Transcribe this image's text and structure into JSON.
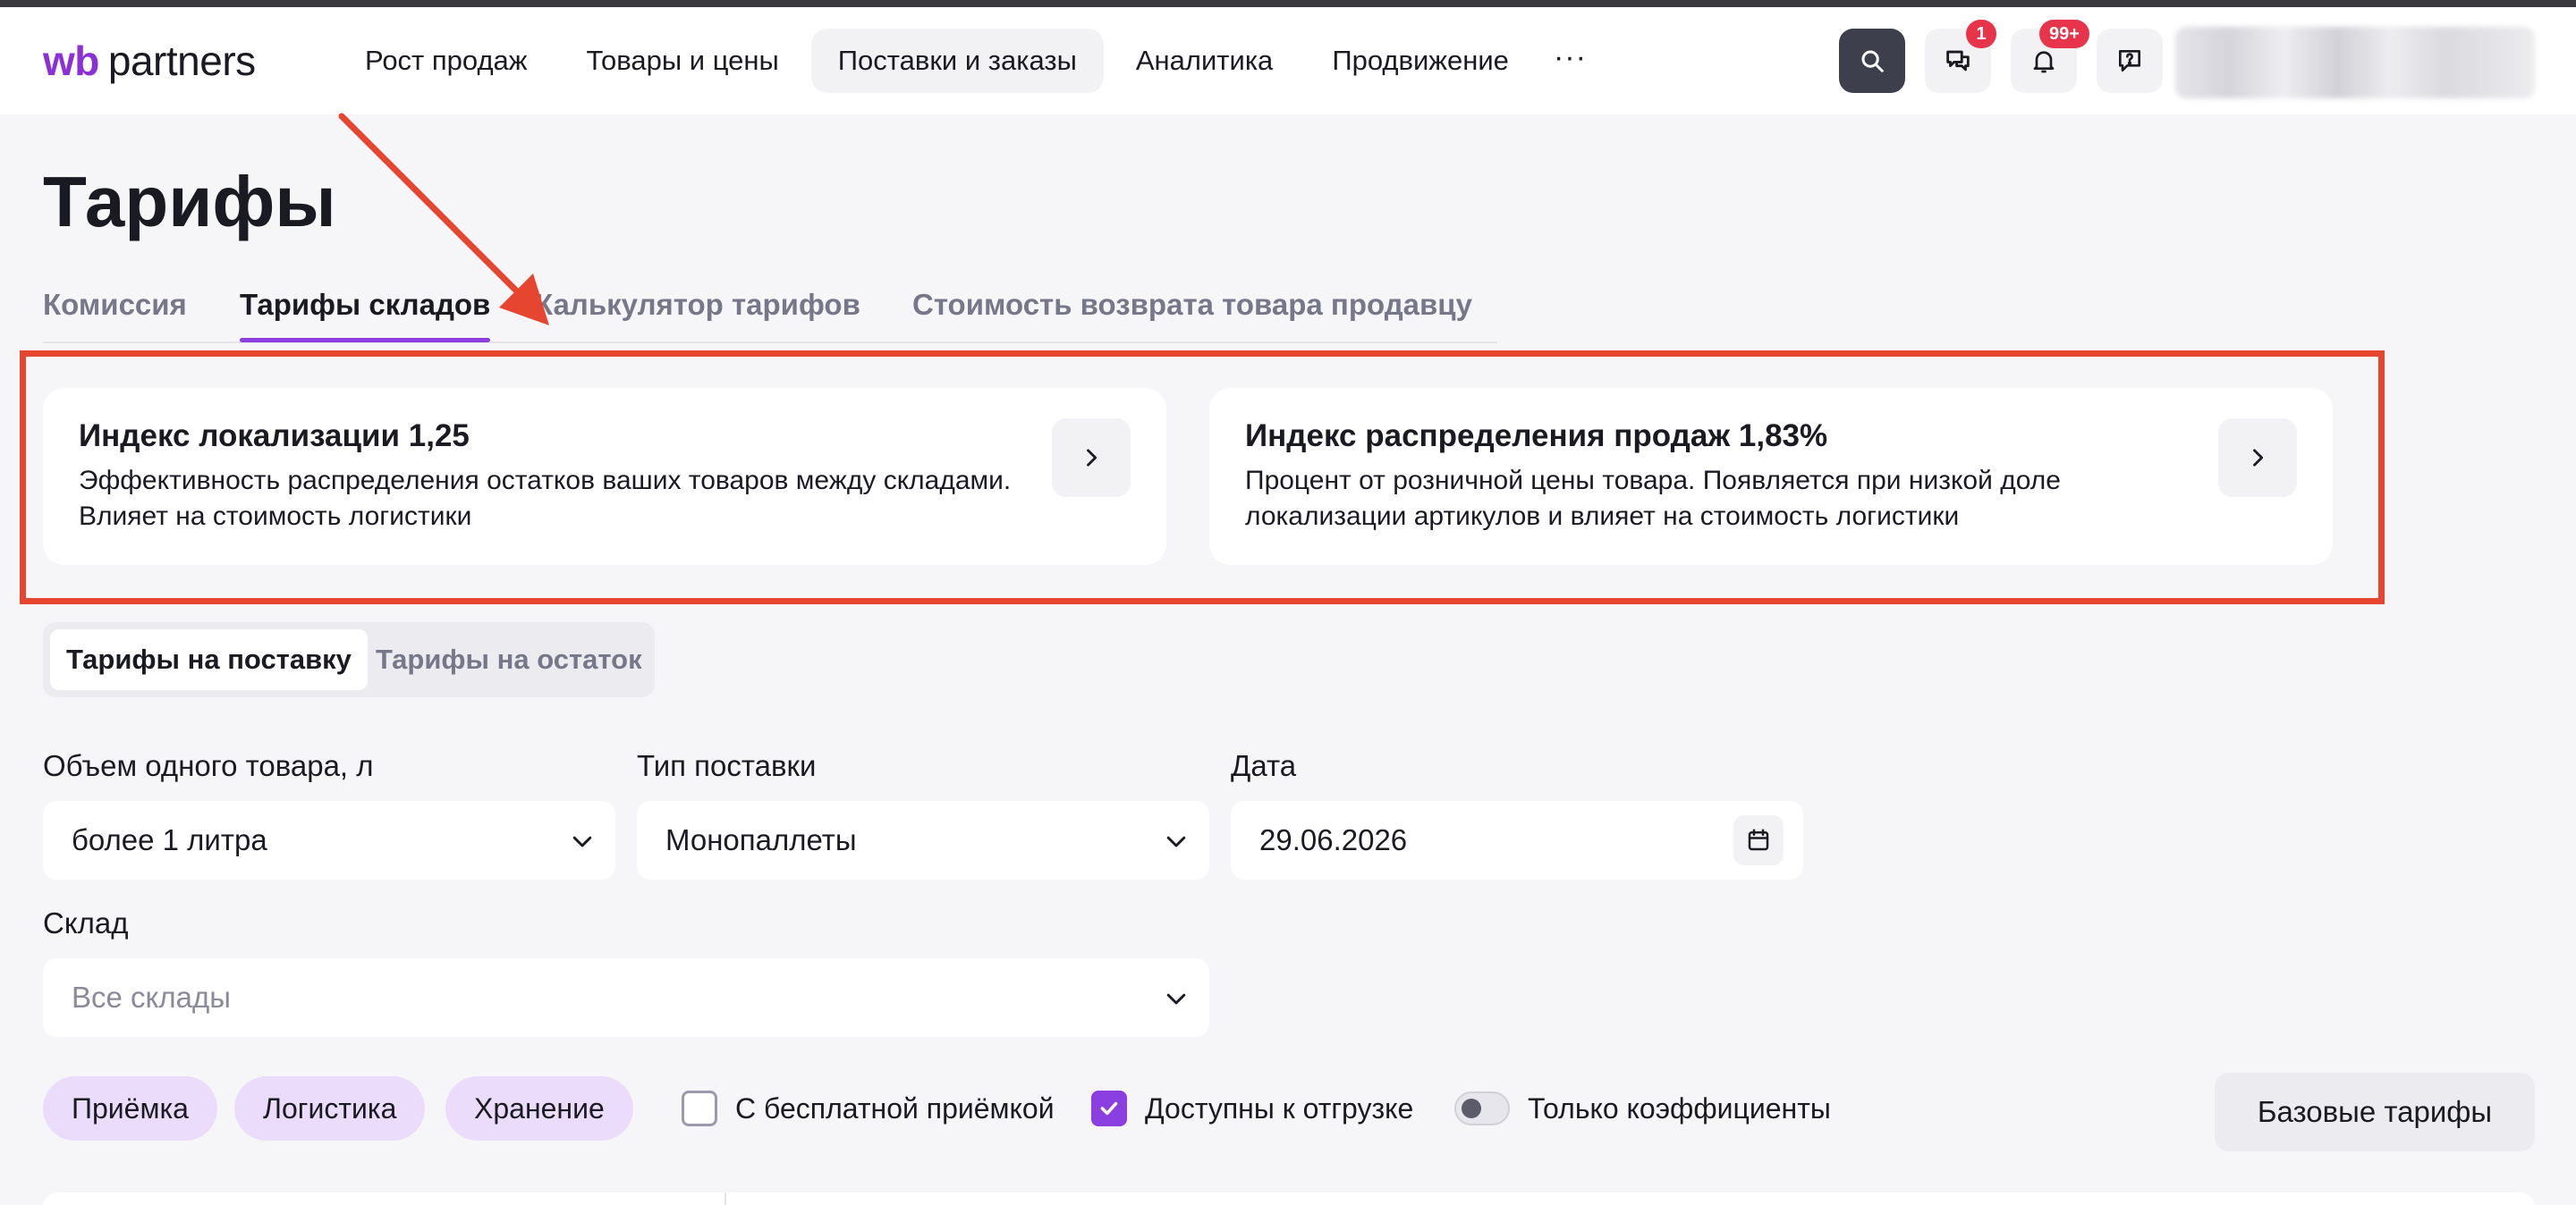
{
  "logo": {
    "wb": "wb",
    "partners": "partners"
  },
  "nav": {
    "items": [
      {
        "label": "Рост продаж"
      },
      {
        "label": "Товары и цены"
      },
      {
        "label": "Поставки и заказы"
      },
      {
        "label": "Аналитика"
      },
      {
        "label": "Продвижение"
      }
    ],
    "more": "···"
  },
  "header": {
    "chat_badge": "1",
    "notifications_badge": "99+"
  },
  "page": {
    "title": "Тарифы"
  },
  "tabs": [
    {
      "label": "Комиссия"
    },
    {
      "label": "Тарифы складов"
    },
    {
      "label": "Калькулятор тарифов"
    },
    {
      "label": "Стоимость возврата товара продавцу"
    }
  ],
  "cards": [
    {
      "title": "Индекс локализации 1,25",
      "description": "Эффективность распределения остатков ваших товаров между складами. Влияет на стоимость логистики"
    },
    {
      "title": "Индекс распределения продаж 1,83%",
      "description": "Процент от розничной цены товара. Появляется при низкой доле локализации артикулов и влияет на стоимость логистики"
    }
  ],
  "segment": {
    "items": [
      {
        "label": "Тарифы на поставку"
      },
      {
        "label": "Тарифы на остаток"
      }
    ]
  },
  "filters": {
    "volume": {
      "label": "Объем одного товара, л",
      "value": "более 1 литра"
    },
    "supply_type": {
      "label": "Тип поставки",
      "value": "Монопаллеты"
    },
    "date": {
      "label": "Дата",
      "value": "29.06.2026"
    },
    "warehouse": {
      "label": "Склад",
      "placeholder": "Все склады"
    }
  },
  "chips": [
    {
      "label": "Приёмка"
    },
    {
      "label": "Логистика"
    },
    {
      "label": "Хранение"
    }
  ],
  "options": {
    "free_acceptance": {
      "label": "С бесплатной приёмкой",
      "checked": false
    },
    "available": {
      "label": "Доступны к отгрузке",
      "checked": true
    },
    "coefficients_only": {
      "label": "Только коэффициенты",
      "on": false
    }
  },
  "base_tariffs_button": "Базовые тарифы",
  "colors": {
    "brand": "#8b2fd6",
    "accent": "#8b3fe0",
    "annotation": "#e6452f",
    "badge": "#e8344a",
    "chip": "#ebdcfb"
  }
}
